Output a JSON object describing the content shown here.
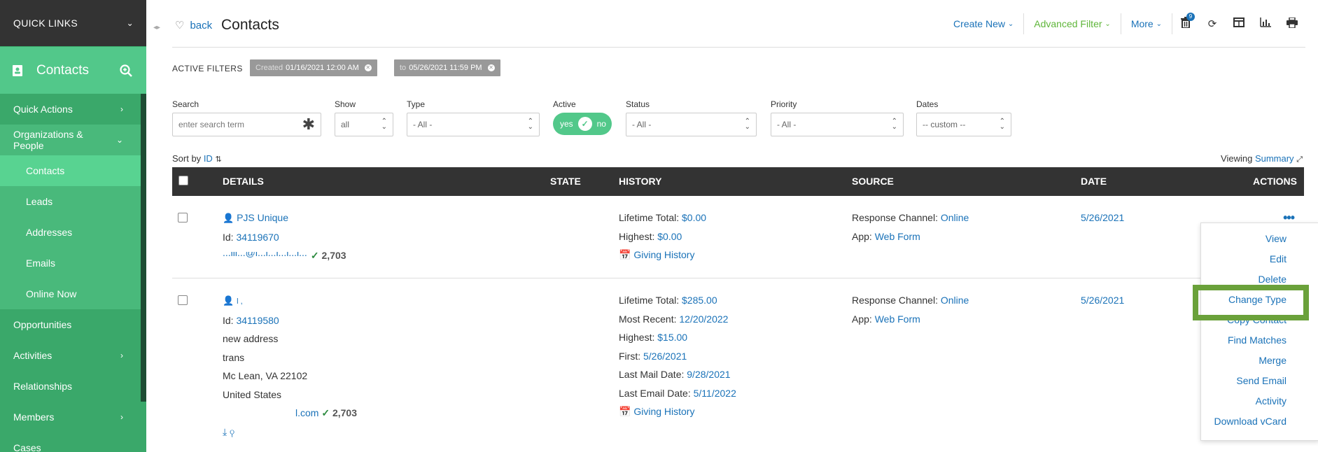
{
  "sidebar": {
    "quick_links": "QUICK LINKS",
    "module_title": "Contacts",
    "items": [
      {
        "label": "Quick Actions",
        "chevron": "›"
      },
      {
        "label": "Organizations & People",
        "chevron": "⌄"
      },
      {
        "label": "Contacts"
      },
      {
        "label": "Leads"
      },
      {
        "label": "Addresses"
      },
      {
        "label": "Emails"
      },
      {
        "label": "Online Now"
      },
      {
        "label": "Opportunities"
      },
      {
        "label": "Activities",
        "chevron": "›"
      },
      {
        "label": "Relationships"
      },
      {
        "label": "Members",
        "chevron": "›"
      },
      {
        "label": "Cases"
      }
    ]
  },
  "header": {
    "back_label": "back",
    "title": "Contacts",
    "create_new": "Create New",
    "advanced_filter": "Advanced Filter",
    "more": "More",
    "trash_badge": "9"
  },
  "filters": {
    "active_label": "ACTIVE FILTERS",
    "chips": [
      {
        "label": "Created",
        "value": "01/16/2021 12:00 AM"
      },
      {
        "label": "to",
        "value": "05/26/2021 11:59 PM"
      }
    ],
    "search": {
      "label": "Search",
      "placeholder": "enter search term"
    },
    "show": {
      "label": "Show",
      "value": "all"
    },
    "type": {
      "label": "Type",
      "value": "- All -"
    },
    "active": {
      "label": "Active",
      "yes": "yes",
      "no": "no"
    },
    "status": {
      "label": "Status",
      "value": "- All -"
    },
    "priority": {
      "label": "Priority",
      "value": "- All -"
    },
    "dates": {
      "label": "Dates",
      "value": "-- custom --"
    }
  },
  "sort": {
    "label": "Sort by",
    "field": "ID"
  },
  "viewing": {
    "label": "Viewing",
    "value": "Summary"
  },
  "table": {
    "headers": [
      "DETAILS",
      "STATE",
      "HISTORY",
      "SOURCE",
      "DATE",
      "ACTIONS"
    ],
    "rows": [
      {
        "name": "PJS Unique",
        "id_label": "Id:",
        "id": "34119670",
        "email_fragment": "...ili...@l...i...l...l...l...",
        "score": "2,703",
        "history": [
          {
            "label": "Lifetime Total:",
            "value": "$0.00"
          },
          {
            "label": "Highest:",
            "value": "$0.00"
          }
        ],
        "giving_history": "Giving History",
        "source": [
          {
            "label": "Response Channel:",
            "value": "Online"
          },
          {
            "label": "App:",
            "value": "Web Form"
          }
        ],
        "date": "5/26/2021"
      },
      {
        "name": "l ,",
        "id_label": "Id:",
        "id": "34119580",
        "address": [
          "new address",
          "trans",
          "Mc Lean, VA 22102",
          "United States"
        ],
        "email_fragment": "l.com",
        "score": "2,703",
        "history": [
          {
            "label": "Lifetime Total:",
            "value": "$285.00"
          },
          {
            "label": "Most Recent:",
            "value": "12/20/2022"
          },
          {
            "label": "Highest:",
            "value": "$15.00"
          },
          {
            "label": "First:",
            "value": "5/26/2021"
          },
          {
            "label": "Last Mail Date:",
            "value": "9/28/2021"
          },
          {
            "label": "Last Email Date:",
            "value": "5/11/2022"
          }
        ],
        "giving_history": "Giving History",
        "source": [
          {
            "label": "Response Channel:",
            "value": "Online"
          },
          {
            "label": "App:",
            "value": "Web Form"
          }
        ],
        "date": "5/26/2021"
      }
    ]
  },
  "actions_menu": [
    "View",
    "Edit",
    "Delete",
    "Change Type",
    "Copy Contact",
    "Find Matches",
    "Merge",
    "Send Email",
    "Activity",
    "Download vCard"
  ],
  "colors": {
    "sidebar": "#3aa86a",
    "accent": "#1a72b8",
    "highlight": "#6aa13a"
  }
}
